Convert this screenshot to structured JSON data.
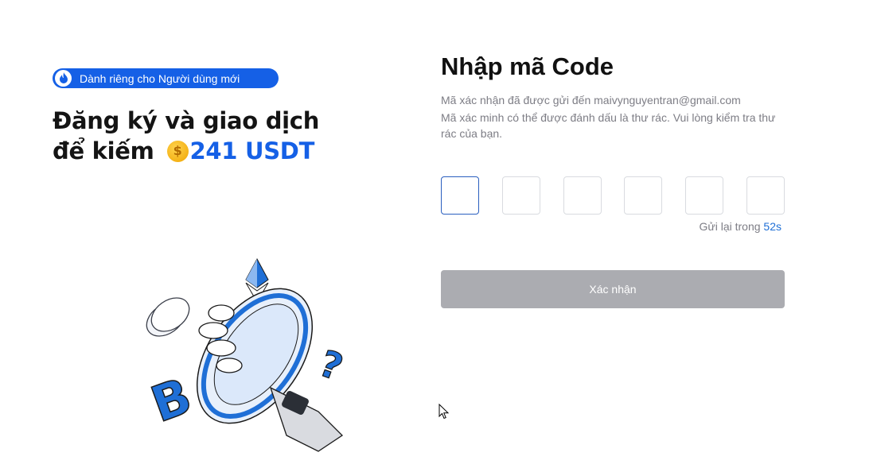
{
  "promo": {
    "badge_text": "Dành riêng cho Người dùng mới",
    "badge_icon": "flame-icon",
    "headline_line1": "Đăng ký và giao dịch",
    "headline_line2_prefix": "để kiếm",
    "coin_icon": "coin-icon",
    "amount": "241 USDT",
    "accent_color": "#1560e6"
  },
  "verify": {
    "title": "Nhập mã Code",
    "sent_message": "Mã xác nhận đã được gửi đến maivynguyentran@gmail.com",
    "spam_notice": "Mã xác minh có thể được đánh dấu là thư rác. Vui lòng kiểm tra thư rác của bạn.",
    "code_length": 6,
    "resend_label": "Gửi lại trong",
    "resend_timer": "52s",
    "confirm_label": "Xác nhận"
  }
}
